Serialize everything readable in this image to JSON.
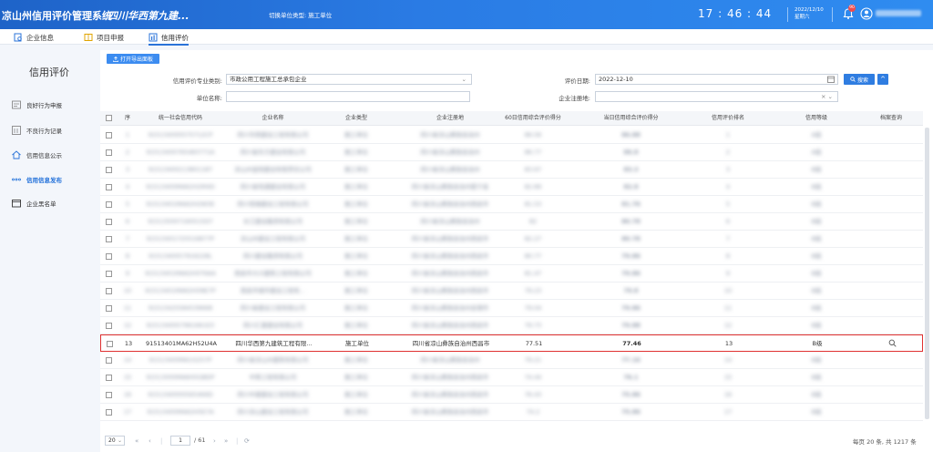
{
  "header": {
    "app_title": "凉山州信用评价管理系统",
    "company": "四川华西第九建...",
    "unit_label": "切换单位类型: 施工单位",
    "clock": "17 : 46 : 44",
    "date": "2022/12/10",
    "weekday": "星期六",
    "badge_count": "90"
  },
  "tabs": [
    {
      "label": "企业信息"
    },
    {
      "label": "项目申报"
    },
    {
      "label": "信用评价"
    }
  ],
  "sidebar": {
    "title": "信用评价",
    "items": [
      {
        "label": "良好行为申报"
      },
      {
        "label": "不良行为记录"
      },
      {
        "label": "信用信息公示"
      },
      {
        "label": "信用信息发布"
      },
      {
        "label": "企业黑名单"
      }
    ]
  },
  "toolbar": {
    "export_label": "打开导出面板"
  },
  "filters": {
    "category_label": "信用评价专业类别:",
    "category_value": "市政公用工程施工总承包企业",
    "date_label": "评价日期:",
    "date_value": "2022-12-10",
    "name_label": "单位名称:",
    "name_value": "",
    "region_label": "企业注册地:",
    "region_value": "",
    "search_label": "搜索"
  },
  "table": {
    "columns": [
      "序",
      "统一社会信用代码",
      "企业名称",
      "企业类型",
      "企业注册地",
      "60日信用综合评价得分",
      "当日信用综合评价得分",
      "信用评价排名",
      "信用等级",
      "档案查询"
    ],
    "rows": [
      {
        "no": "1",
        "code": "915134000575712CP",
        "name": "四川华西建设工程有限公司",
        "type": "施工单位",
        "region": "四川省凉山彝族自治州",
        "score60": "86.56",
        "today": "86.88",
        "rank": "1",
        "grade": "A级"
      },
      {
        "no": "2",
        "code": "91513400765483771A",
        "name": "四川省东方建设有限公司",
        "type": "施工单位",
        "region": "四川省凉山彝族自治州",
        "score60": "86.77",
        "today": "86.8",
        "rank": "2",
        "grade": "A级"
      },
      {
        "no": "3",
        "code": "91513400213801187",
        "name": "凉山州金阳建设有限责任公司",
        "type": "施工单位",
        "region": "四川省凉山彝族自治州",
        "score60": "83.67",
        "today": "83.3",
        "rank": "3",
        "grade": "B级"
      },
      {
        "no": "4",
        "code": "91513400MA62H2M4D",
        "name": "四川省恒通建设有限公司",
        "type": "施工单位",
        "region": "四川省凉山彝族自治州冕宁县",
        "score60": "82.89",
        "today": "82.8",
        "rank": "4",
        "grade": "B级"
      },
      {
        "no": "5",
        "code": "91513401MA62H2W3E",
        "name": "四川恒瑞建设工程有限公司",
        "type": "施工单位",
        "region": "四川省凉山彝族自治州西昌市",
        "score60": "81.53",
        "today": "81.76",
        "rank": "5",
        "grade": "B级"
      },
      {
        "no": "6",
        "code": "915135007160515D7",
        "name": "长江建设集团有限公司",
        "type": "施工单位",
        "region": "四川省凉山彝族自治州",
        "score60": "82",
        "today": "80.78",
        "rank": "6",
        "grade": "B级"
      },
      {
        "no": "7",
        "code": "91513401725516877P",
        "name": "凉山州建设工程有限公司",
        "type": "施工单位",
        "region": "四川省凉山彝族自治州西昌市",
        "score60": "82.27",
        "today": "80.78",
        "rank": "7",
        "grade": "B级"
      },
      {
        "no": "8",
        "code": "9151340057916228L",
        "name": "四川建设集团有限公司",
        "type": "施工单位",
        "region": "四川省凉山彝族自治州西昌市",
        "score60": "80.77",
        "today": "79.86",
        "rank": "8",
        "grade": "B级"
      },
      {
        "no": "9",
        "code": "91513401MA62H5T6AA",
        "name": "西昌市大兴建筑工程有限公司",
        "type": "施工单位",
        "region": "四川省凉山彝族自治州西昌市",
        "score60": "81.47",
        "today": "79.86",
        "rank": "9",
        "grade": "B级"
      },
      {
        "no": "10",
        "code": "91513401MA62H5NE7P",
        "name": "西昌市城市建设工程有...",
        "type": "施工单位",
        "region": "四川省凉山彝族自治州西昌市",
        "score60": "79.23",
        "today": "79.8",
        "rank": "10",
        "grade": "B级"
      },
      {
        "no": "11",
        "code": "91513425584539668",
        "name": "四川省建设工程有限公司",
        "type": "施工单位",
        "region": "四川省凉山彝族自治州会理市",
        "score60": "79.04",
        "today": "79.86",
        "rank": "11",
        "grade": "B级"
      },
      {
        "no": "12",
        "code": "9151340057961661E3",
        "name": "四川汇建建设有限公司",
        "type": "施工单位",
        "region": "四川省凉山彝族自治州西昌市",
        "score60": "79.73",
        "today": "79.88",
        "rank": "12",
        "grade": "B级"
      },
      {
        "no": "13",
        "code": "91513401MA62H52U4A",
        "name": "四川华西第九建筑工程有限...",
        "type": "施工单位",
        "region": "四川省凉山彝族自治州西昌市",
        "score60": "77.51",
        "today": "77.46",
        "rank": "13",
        "grade": "B级"
      },
      {
        "no": "14",
        "code": "91513400MA1G257P",
        "name": "四川省凉山州建筑有限公司",
        "type": "施工单位",
        "region": "四川省凉山彝族自治州",
        "score60": "79.21",
        "today": "77.16",
        "rank": "14",
        "grade": "B级"
      },
      {
        "no": "15",
        "code": "91513000MA6H5GBDP",
        "name": "中铁工程有限公司",
        "type": "施工单位",
        "region": "四川省凉山彝族自治州西昌市",
        "score60": "74.44",
        "today": "76.1",
        "rank": "15",
        "grade": "B级"
      },
      {
        "no": "16",
        "code": "9151340000565466D",
        "name": "四川中建建设工程有限公司",
        "type": "施工单位",
        "region": "四川省凉山彝族自治州西昌市",
        "score60": "76.43",
        "today": "75.86",
        "rank": "16",
        "grade": "B级"
      },
      {
        "no": "17",
        "code": "91513400MA62H5E7A",
        "name": "四川凉山建设工程有限公司",
        "type": "施工单位",
        "region": "四川省凉山彝族自治州西昌市",
        "score60": "74.2",
        "today": "75.86",
        "rank": "17",
        "grade": "B级"
      }
    ]
  },
  "pager": {
    "page_size": "20",
    "current_page": "1",
    "total_pages": "/ 61",
    "summary": "每页 20 条, 共 1217 条"
  }
}
